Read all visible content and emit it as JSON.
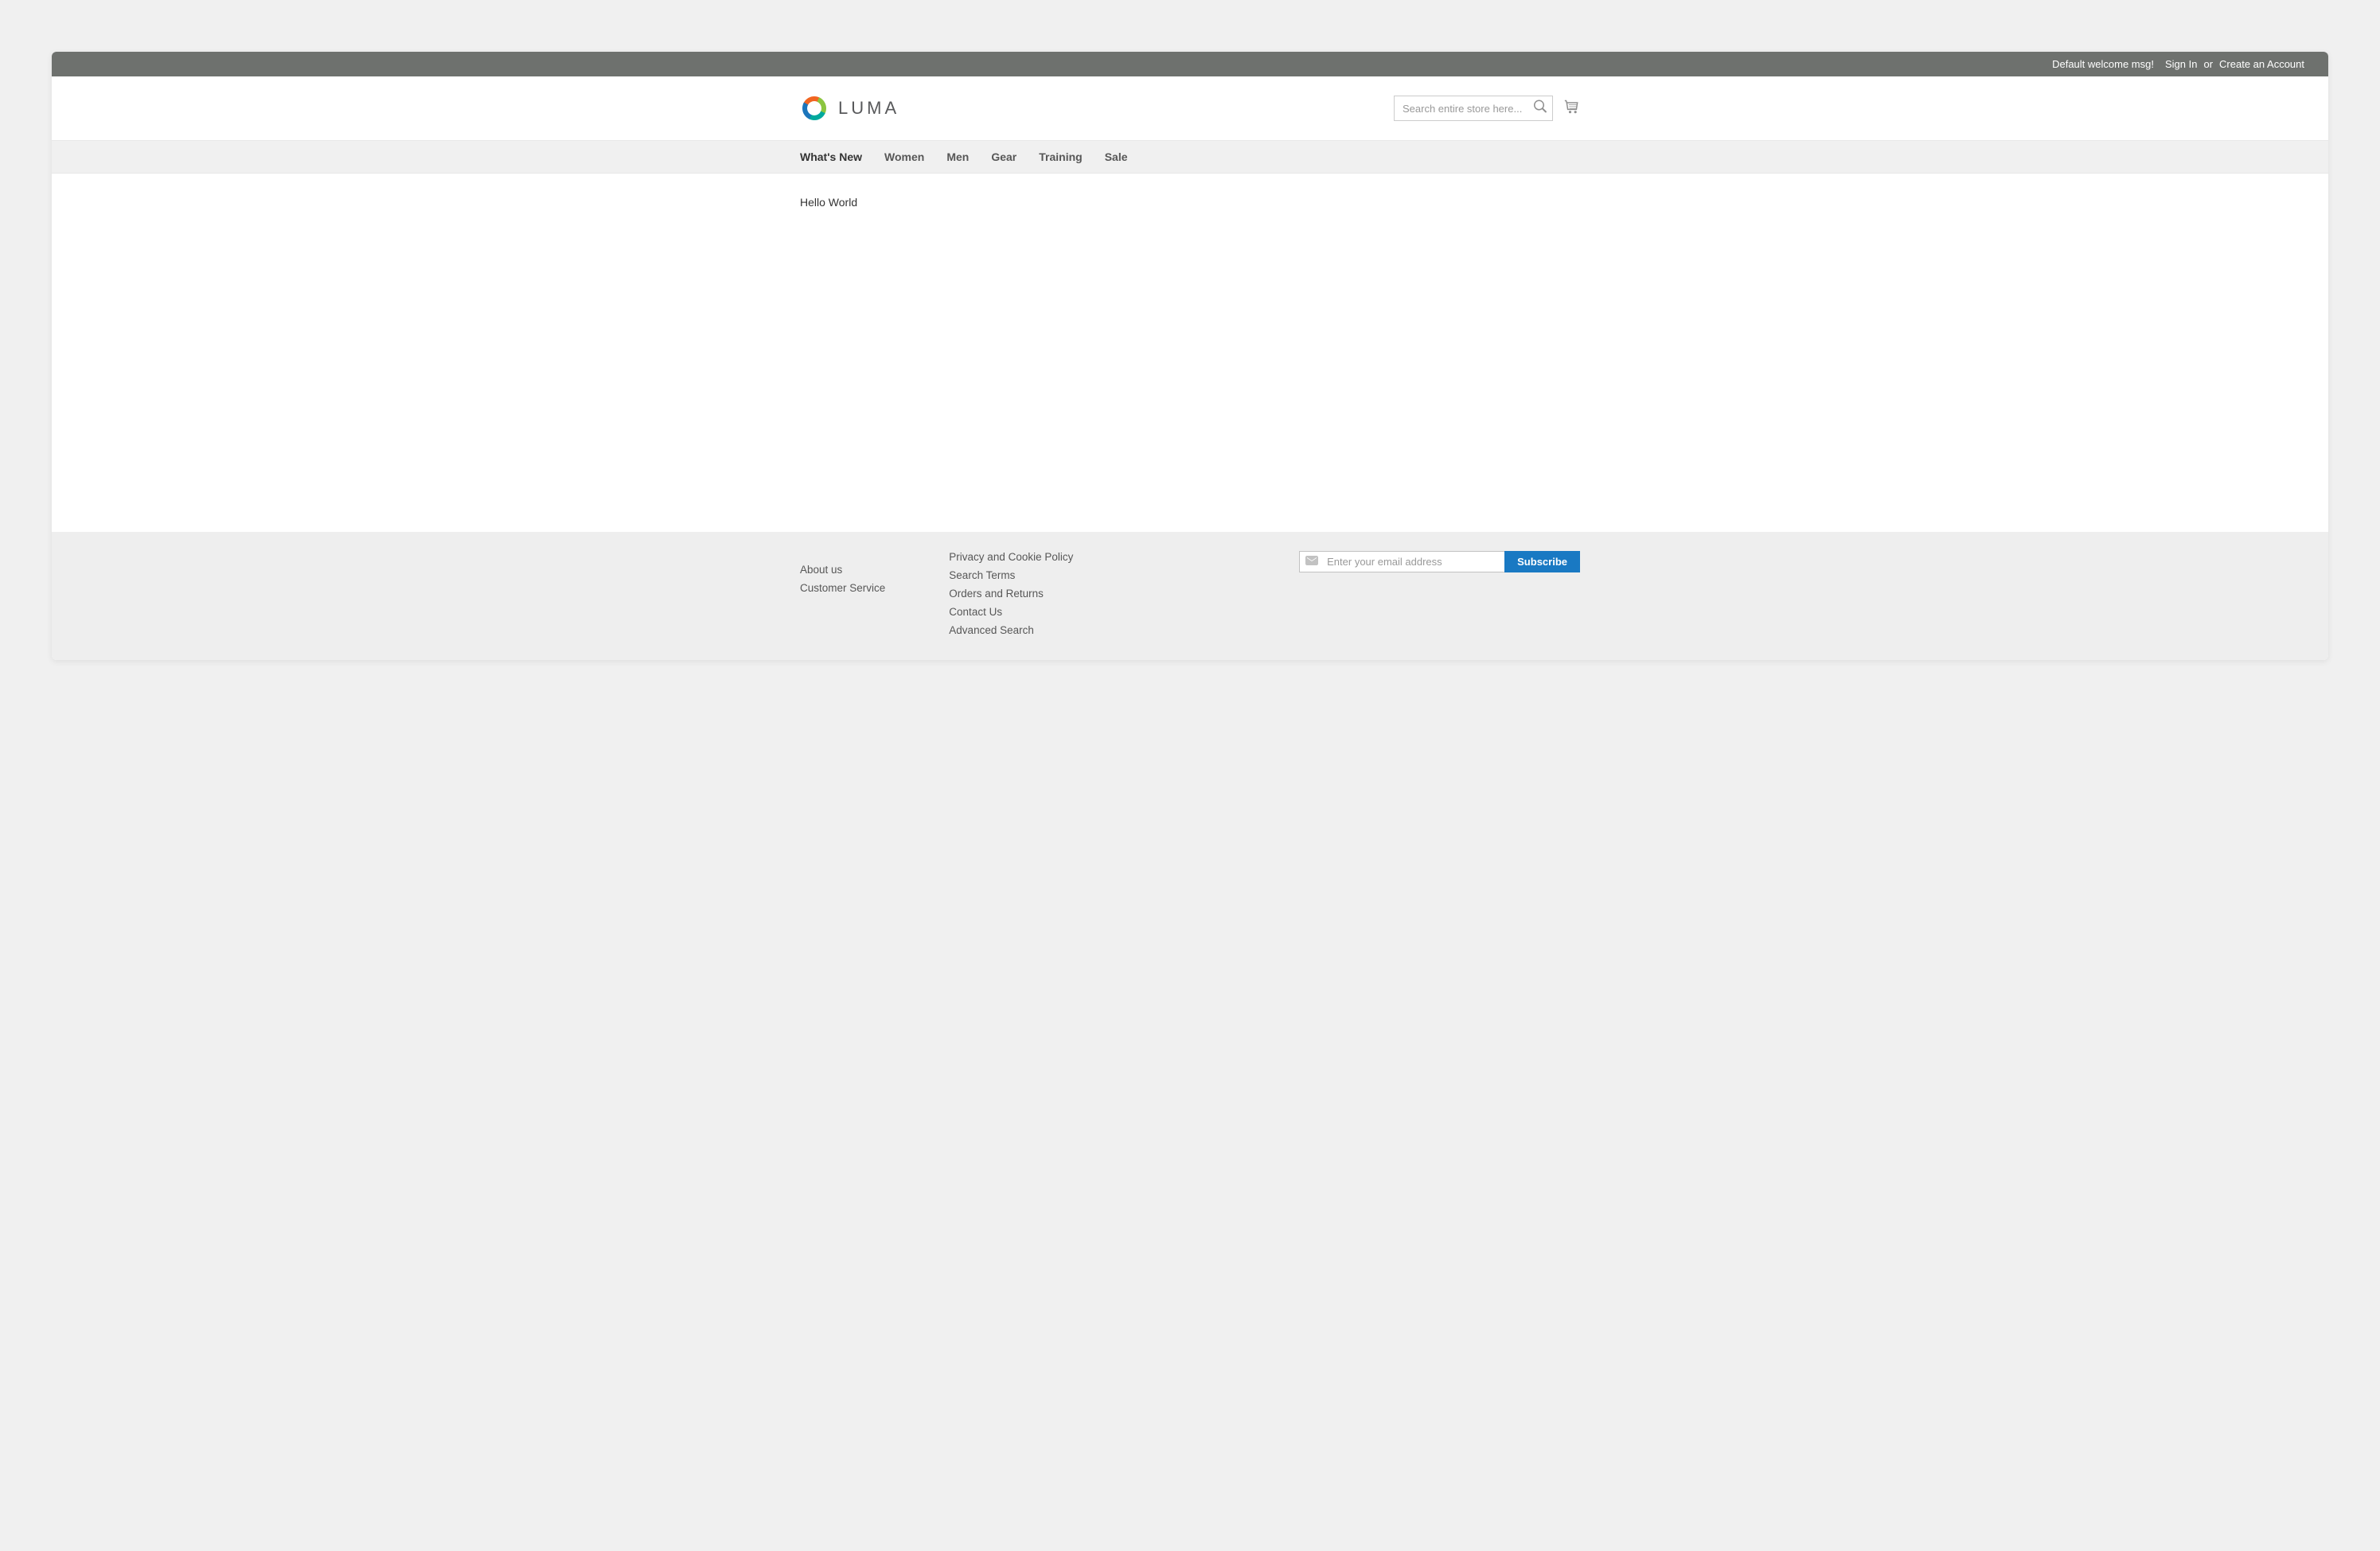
{
  "topbar": {
    "welcome": "Default welcome msg!",
    "signin": "Sign In",
    "or": "or",
    "create_account": "Create an Account"
  },
  "logo": {
    "text": "LUMA"
  },
  "search": {
    "placeholder": "Search entire store here..."
  },
  "nav": {
    "items": [
      {
        "label": "What's New"
      },
      {
        "label": "Women"
      },
      {
        "label": "Men"
      },
      {
        "label": "Gear"
      },
      {
        "label": "Training"
      },
      {
        "label": "Sale"
      }
    ]
  },
  "content": {
    "text": "Hello World"
  },
  "footer": {
    "col1": [
      {
        "label": "About us"
      },
      {
        "label": "Customer Service"
      }
    ],
    "col2": [
      {
        "label": "Privacy and Cookie Policy"
      },
      {
        "label": "Search Terms"
      },
      {
        "label": "Orders and Returns"
      },
      {
        "label": "Contact Us"
      },
      {
        "label": "Advanced Search"
      }
    ],
    "subscribe": {
      "placeholder": "Enter your email address",
      "button": "Subscribe"
    }
  }
}
